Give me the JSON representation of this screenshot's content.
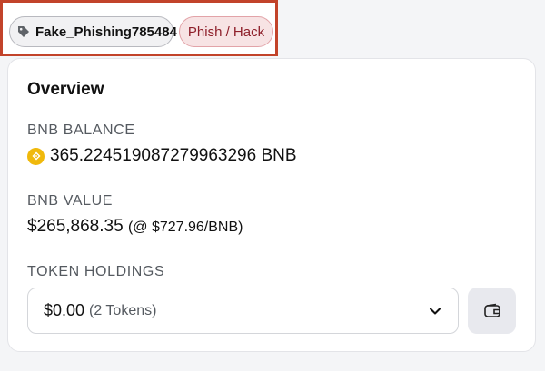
{
  "tags": {
    "name_tag": "Fake_Phishing785484",
    "category_tag": "Phish / Hack"
  },
  "overview": {
    "title": "Overview",
    "balance_label": "BNB BALANCE",
    "balance_value": "365.224519087279963296 BNB",
    "value_label": "BNB VALUE",
    "value_amount": "$265,868.35",
    "value_rate": "(@ $727.96/BNB)",
    "holdings_label": "TOKEN HOLDINGS",
    "holdings_value": "$0.00",
    "holdings_count": "(2 Tokens)"
  },
  "colors": {
    "highlight_border": "#c2432a",
    "bnb_yellow": "#f0b90b",
    "hack_text": "#8e1f2a"
  },
  "icons": [
    "tag-icon",
    "bnb-coin-icon",
    "chevron-down-icon",
    "wallet-icon"
  ]
}
